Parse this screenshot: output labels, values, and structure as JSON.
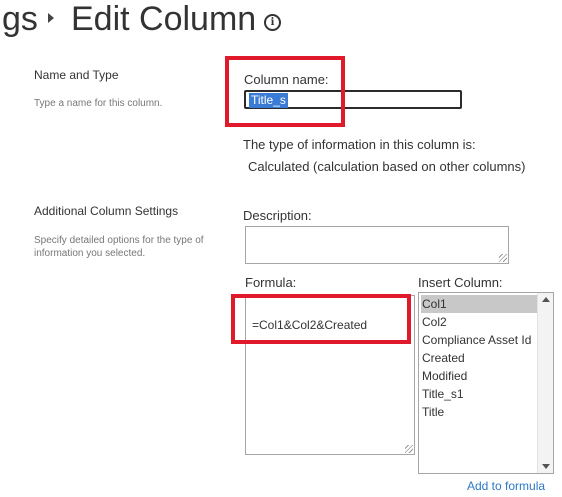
{
  "header": {
    "breadcrumb_fragment": "gs",
    "title": "Edit Column",
    "info_symbol": "i"
  },
  "sections": {
    "name_type": {
      "title": "Name and Type",
      "description": "Type a name for this column."
    },
    "additional": {
      "title": "Additional Column Settings",
      "description_line1": "Specify detailed options for the type of",
      "description_line2": "information you selected."
    }
  },
  "column_name": {
    "label": "Column name:",
    "value": "Title_s"
  },
  "type_info": {
    "label": "The type of information in this column is:",
    "value": "Calculated (calculation based on other columns)"
  },
  "description_field": {
    "label": "Description:",
    "value": ""
  },
  "formula": {
    "label": "Formula:",
    "value": "=Col1&Col2&Created"
  },
  "insert_column": {
    "label": "Insert Column:",
    "items": [
      "Col1",
      "Col2",
      "Compliance Asset Id",
      "Created",
      "Modified",
      "Title_s1",
      "Title"
    ],
    "selected": "Col1"
  },
  "add_to_formula": {
    "label": "Add to formula"
  },
  "colors": {
    "highlight": "#e01a2b",
    "link": "#2b78c5",
    "selection": "#3a7bd5"
  }
}
